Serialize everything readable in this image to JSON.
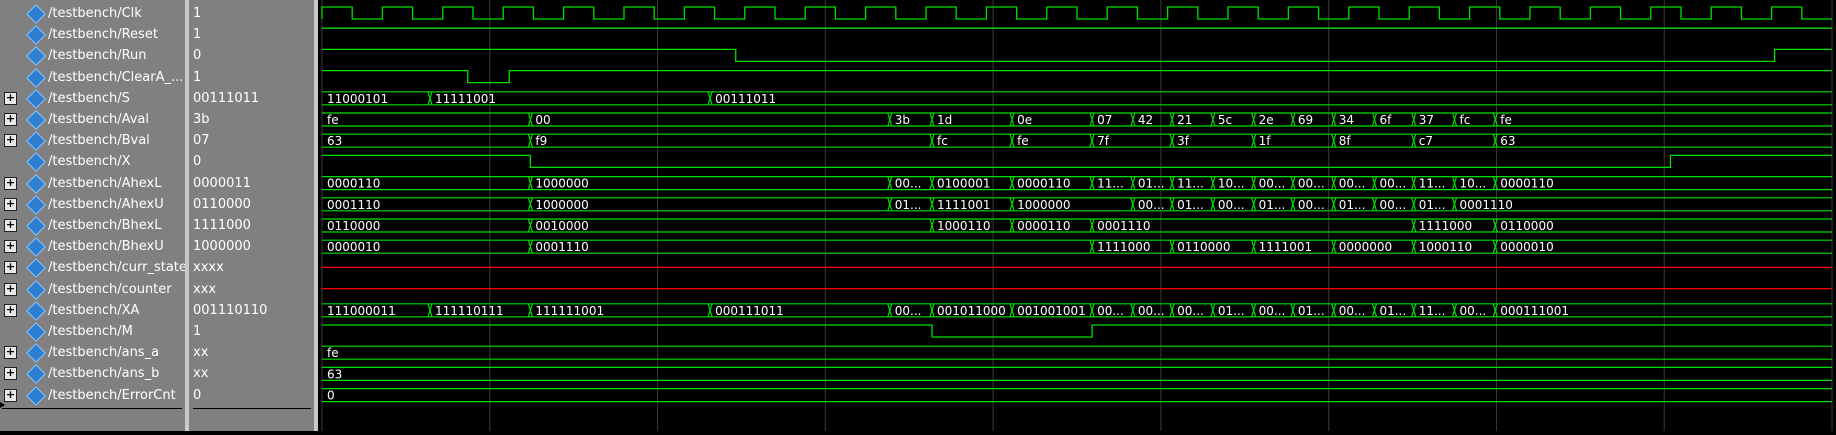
{
  "signals": [
    {
      "name": "/testbench/Clk",
      "value": "1",
      "expandable": false
    },
    {
      "name": "/testbench/Reset",
      "value": "1",
      "expandable": false
    },
    {
      "name": "/testbench/Run",
      "value": "0",
      "expandable": false
    },
    {
      "name": "/testbench/ClearA_...",
      "value": "1",
      "expandable": false
    },
    {
      "name": "/testbench/S",
      "value": "00111011",
      "expandable": true
    },
    {
      "name": "/testbench/Aval",
      "value": "3b",
      "expandable": true
    },
    {
      "name": "/testbench/Bval",
      "value": "07",
      "expandable": true
    },
    {
      "name": "/testbench/X",
      "value": "0",
      "expandable": false
    },
    {
      "name": "/testbench/AhexL",
      "value": "0000011",
      "expandable": true
    },
    {
      "name": "/testbench/AhexU",
      "value": "0110000",
      "expandable": true
    },
    {
      "name": "/testbench/BhexL",
      "value": "1111000",
      "expandable": true
    },
    {
      "name": "/testbench/BhexU",
      "value": "1000000",
      "expandable": true
    },
    {
      "name": "/testbench/curr_state",
      "value": "xxxx",
      "expandable": true
    },
    {
      "name": "/testbench/counter",
      "value": "xxx",
      "expandable": true
    },
    {
      "name": "/testbench/XA",
      "value": "001110110",
      "expandable": true
    },
    {
      "name": "/testbench/M",
      "value": "1",
      "expandable": false
    },
    {
      "name": "/testbench/ans_a",
      "value": "xx",
      "expandable": true
    },
    {
      "name": "/testbench/ans_b",
      "value": "xx",
      "expandable": true
    },
    {
      "name": "/testbench/ErrorCnt",
      "value": "0",
      "expandable": true
    }
  ],
  "expand_glyph": "+",
  "waveforms": {
    "clock": {
      "period_cycles": 25
    },
    "reset": [
      [
        "1",
        0,
        1
      ]
    ],
    "run": [
      [
        "1",
        0,
        0.274
      ],
      [
        "0",
        0.274,
        0.962
      ],
      [
        "1",
        0.962,
        1
      ]
    ],
    "clear": [
      [
        "1",
        0,
        0.0965
      ],
      [
        "0",
        0.0965,
        0.124
      ],
      [
        "1",
        0.124,
        1
      ]
    ],
    "x": [
      [
        "1",
        0,
        0.138
      ],
      [
        "0",
        0.138,
        0.893
      ],
      [
        "1",
        0.893,
        1
      ]
    ],
    "m": [
      [
        "1",
        0,
        0.404
      ],
      [
        "0",
        0.404,
        0.51
      ],
      [
        "1",
        0.51,
        1
      ]
    ],
    "S": [
      [
        0,
        "11000101"
      ],
      [
        0.0715,
        "11111001"
      ],
      [
        0.257,
        "00111011"
      ]
    ],
    "Aval": [
      [
        0,
        "fe"
      ],
      [
        0.138,
        "00"
      ],
      [
        0.376,
        "3b"
      ],
      [
        0.404,
        "1d"
      ],
      [
        0.457,
        "0e"
      ],
      [
        0.51,
        "07"
      ],
      [
        0.537,
        "42"
      ],
      [
        0.563,
        "21"
      ],
      [
        0.59,
        "5c"
      ],
      [
        0.617,
        "2e"
      ],
      [
        0.643,
        "69"
      ],
      [
        0.67,
        "34"
      ],
      [
        0.697,
        "6f"
      ],
      [
        0.723,
        "37"
      ],
      [
        0.75,
        "fc"
      ],
      [
        0.777,
        "fe"
      ]
    ],
    "Bval": [
      [
        0,
        "63"
      ],
      [
        0.138,
        "f9"
      ],
      [
        0.404,
        "fc"
      ],
      [
        0.457,
        "fe"
      ],
      [
        0.51,
        "7f"
      ],
      [
        0.563,
        "3f"
      ],
      [
        0.617,
        "1f"
      ],
      [
        0.67,
        "8f"
      ],
      [
        0.723,
        "c7"
      ],
      [
        0.777,
        "63"
      ]
    ],
    "AhexL": [
      [
        0,
        "0000110"
      ],
      [
        0.138,
        "1000000"
      ],
      [
        0.376,
        "00..."
      ],
      [
        0.404,
        "0100001"
      ],
      [
        0.457,
        "0000110"
      ],
      [
        0.51,
        "11..."
      ],
      [
        0.537,
        "01..."
      ],
      [
        0.563,
        "11..."
      ],
      [
        0.59,
        "10..."
      ],
      [
        0.617,
        "00..."
      ],
      [
        0.643,
        "00..."
      ],
      [
        0.67,
        "00..."
      ],
      [
        0.697,
        "00..."
      ],
      [
        0.723,
        "11..."
      ],
      [
        0.75,
        "10..."
      ],
      [
        0.777,
        "0000110"
      ]
    ],
    "AhexU": [
      [
        0,
        "0001110"
      ],
      [
        0.138,
        "1000000"
      ],
      [
        0.376,
        "01..."
      ],
      [
        0.404,
        "1111001"
      ],
      [
        0.457,
        "1000000"
      ],
      [
        0.537,
        "00..."
      ],
      [
        0.563,
        "01..."
      ],
      [
        0.59,
        "00..."
      ],
      [
        0.617,
        "01..."
      ],
      [
        0.643,
        "00..."
      ],
      [
        0.67,
        "01..."
      ],
      [
        0.697,
        "00..."
      ],
      [
        0.723,
        "01..."
      ],
      [
        0.75,
        "0001110"
      ]
    ],
    "BhexL": [
      [
        0,
        "0110000"
      ],
      [
        0.138,
        "0010000"
      ],
      [
        0.404,
        "1000110"
      ],
      [
        0.457,
        "0000110"
      ],
      [
        0.51,
        "0001110"
      ],
      [
        0.723,
        "1111000"
      ],
      [
        0.777,
        "0110000"
      ]
    ],
    "BhexU": [
      [
        0,
        "0000010"
      ],
      [
        0.138,
        "0001110"
      ],
      [
        0.51,
        "1111000"
      ],
      [
        0.563,
        "0110000"
      ],
      [
        0.617,
        "1111001"
      ],
      [
        0.67,
        "0000000"
      ],
      [
        0.723,
        "1000110"
      ],
      [
        0.777,
        "0000010"
      ]
    ],
    "XA": [
      [
        0,
        "111000011"
      ],
      [
        0.0715,
        "111110111"
      ],
      [
        0.138,
        "111111001"
      ],
      [
        0.257,
        "000111011"
      ],
      [
        0.376,
        "00..."
      ],
      [
        0.404,
        "001011000"
      ],
      [
        0.457,
        "001001001"
      ],
      [
        0.51,
        "00..."
      ],
      [
        0.537,
        "00..."
      ],
      [
        0.563,
        "00..."
      ],
      [
        0.59,
        "01..."
      ],
      [
        0.617,
        "00..."
      ],
      [
        0.643,
        "01..."
      ],
      [
        0.67,
        "00..."
      ],
      [
        0.697,
        "01..."
      ],
      [
        0.723,
        "11..."
      ],
      [
        0.75,
        "00..."
      ],
      [
        0.777,
        "000111001"
      ]
    ],
    "ans_a": [
      [
        0,
        "fe"
      ]
    ],
    "ans_b": [
      [
        0,
        "63"
      ]
    ],
    "ErrorCnt": [
      [
        0,
        "0"
      ]
    ]
  },
  "colors": {
    "wave": "#00dd00",
    "unknown": "#ff0000",
    "background": "#000000",
    "panel": "#808080",
    "separator": "#c8c8c8",
    "grid": "#3a3a3a"
  }
}
